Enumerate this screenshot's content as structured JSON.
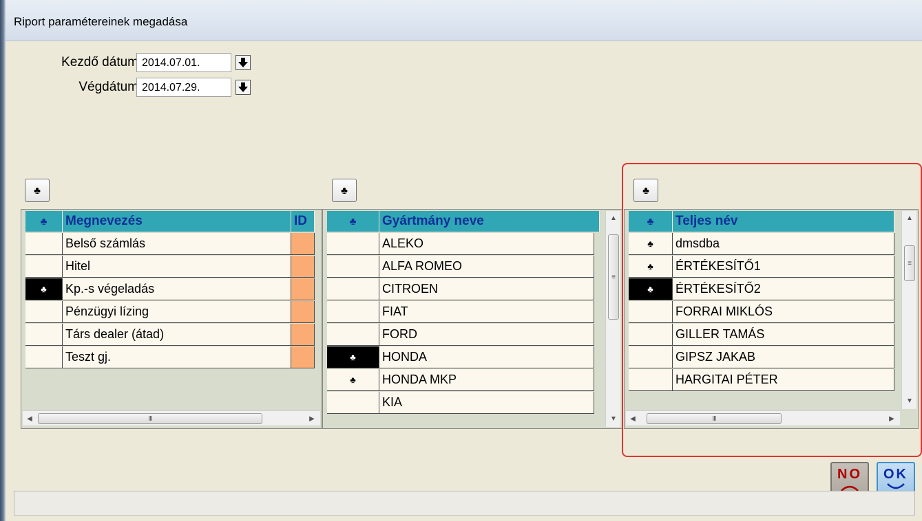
{
  "window": {
    "title": "Riport paramétereinek megadása"
  },
  "dates": {
    "start_label": "Kezdő dátum",
    "start_value": "2014.07.01.",
    "end_label": "Végdátum",
    "end_value": "2014.07.29."
  },
  "grid1": {
    "header_name": "Megnevezés",
    "header_id": "ID",
    "rows": [
      {
        "name": "Belső számlás",
        "selected": false,
        "current": false
      },
      {
        "name": "Hitel",
        "selected": false,
        "current": false
      },
      {
        "name": "Kp.-s végeladás",
        "selected": true,
        "current": true
      },
      {
        "name": "Pénzügyi lízing",
        "selected": false,
        "current": false
      },
      {
        "name": "Társ dealer (átad)",
        "selected": false,
        "current": false
      },
      {
        "name": "Teszt gj.",
        "selected": false,
        "current": false
      }
    ]
  },
  "grid2": {
    "header_name": "Gyártmány neve",
    "rows": [
      {
        "name": "ALEKO",
        "selected": false,
        "current": false
      },
      {
        "name": "ALFA ROMEO",
        "selected": false,
        "current": false
      },
      {
        "name": "CITROEN",
        "selected": false,
        "current": false
      },
      {
        "name": "FIAT",
        "selected": false,
        "current": false
      },
      {
        "name": "FORD",
        "selected": false,
        "current": false
      },
      {
        "name": "HONDA",
        "selected": true,
        "current": true
      },
      {
        "name": "HONDA MKP",
        "selected": true,
        "current": false
      },
      {
        "name": "KIA",
        "selected": false,
        "current": false
      }
    ]
  },
  "grid3": {
    "header_name": "Teljes név",
    "rows": [
      {
        "name": "dmsdba",
        "selected": true,
        "current": false
      },
      {
        "name": "ÉRTÉKESÍTŐ1",
        "selected": true,
        "current": false
      },
      {
        "name": "ÉRTÉKESÍTŐ2",
        "selected": true,
        "current": true
      },
      {
        "name": "FORRAI MIKLÓS",
        "selected": false,
        "current": false
      },
      {
        "name": "GILLER TAMÁS",
        "selected": false,
        "current": false
      },
      {
        "name": "GIPSZ JAKAB",
        "selected": false,
        "current": false
      },
      {
        "name": "HARGITAI PÉTER",
        "selected": false,
        "current": false
      }
    ]
  },
  "icons": {
    "club": "♣",
    "scroll_left": "◀",
    "scroll_right": "▶",
    "scroll_up": "▲",
    "scroll_down": "▼",
    "grip_h": "III",
    "grip_v": "≡"
  },
  "buttons": {
    "no_label": "NO",
    "ok_label": "OK"
  },
  "colors": {
    "header_bg": "#31a6b4",
    "header_text": "#0f2f9a",
    "row_bg": "#fdf8ee",
    "id_cell": "#fbac74",
    "highlight": "#e2332f"
  }
}
